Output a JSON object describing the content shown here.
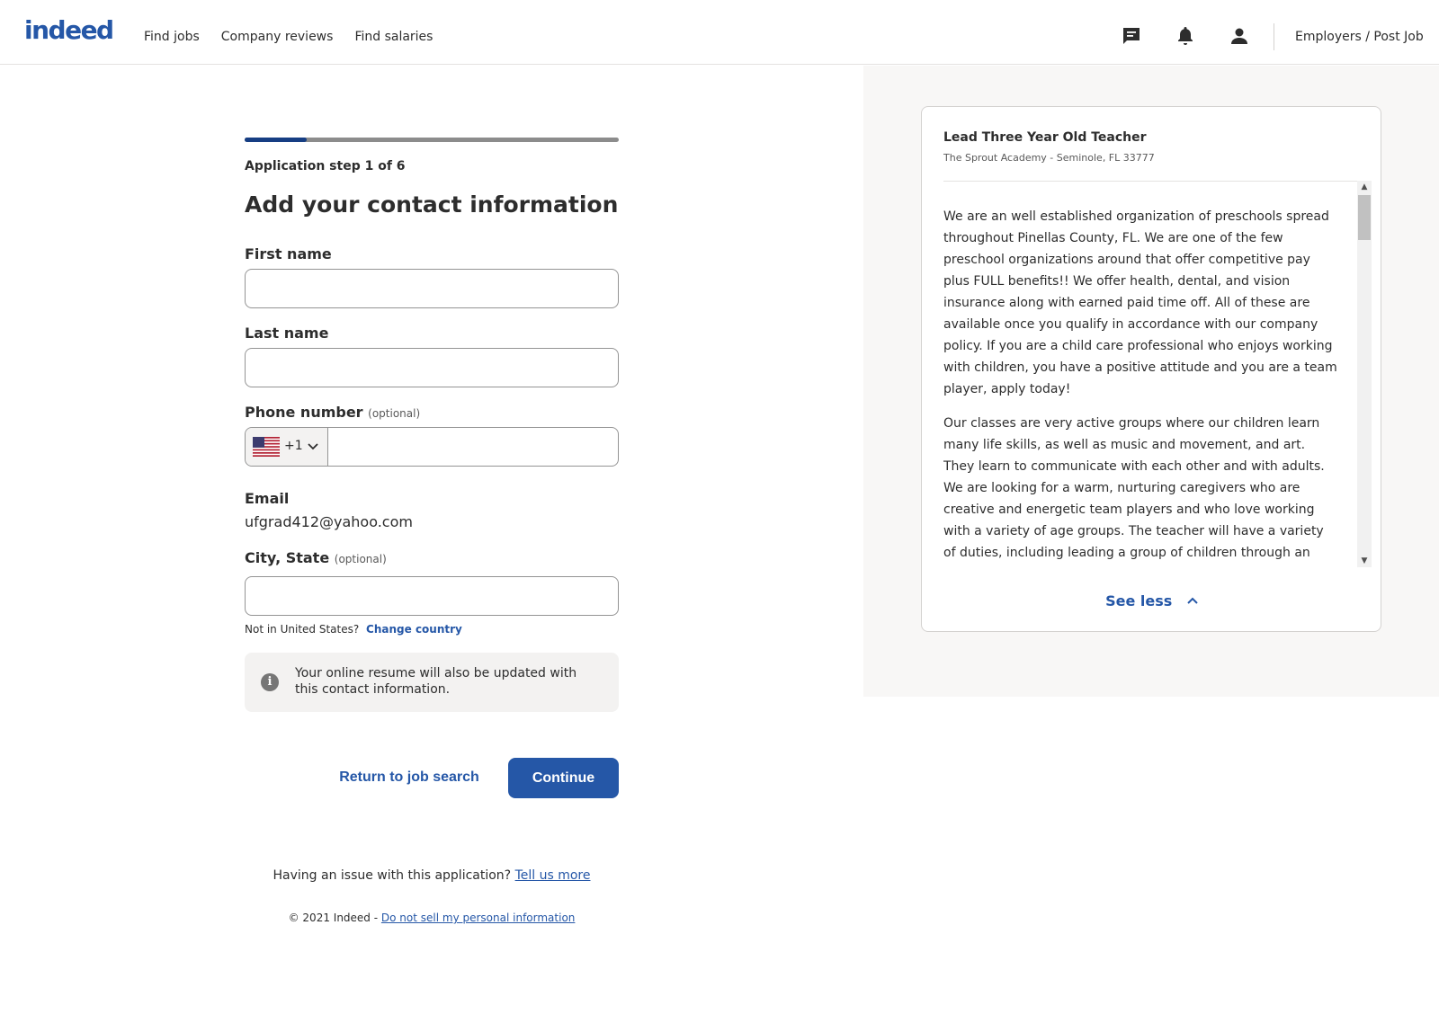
{
  "header": {
    "logo_text": "indeed",
    "nav": [
      "Find jobs",
      "Company reviews",
      "Find salaries"
    ],
    "icons": [
      "messages-icon",
      "notifications-icon",
      "profile-icon"
    ],
    "employers_link": "Employers / Post Job"
  },
  "form": {
    "progress_fraction": 0.1667,
    "step_label": "Application step 1 of 6",
    "title": "Add your contact information",
    "first_name": {
      "label": "First name",
      "value": ""
    },
    "last_name": {
      "label": "Last name",
      "value": ""
    },
    "phone": {
      "label": "Phone number",
      "optional": "(optional)",
      "dial_code": "+1",
      "value": ""
    },
    "email": {
      "label": "Email",
      "value": "ufgrad412@yahoo.com"
    },
    "city_state": {
      "label": "City, State",
      "optional": "(optional)",
      "value": ""
    },
    "not_in_country": "Not in United States?",
    "change_country": "Change country",
    "info_text": "Your online resume will also be updated with this contact information.",
    "return_button": "Return to job search",
    "continue_button": "Continue",
    "issue_text": "Having an issue with this application?",
    "issue_link": "Tell us more",
    "copyright": "© 2021 Indeed -",
    "privacy_link": "Do not sell my personal information"
  },
  "job": {
    "title": "Lead Three Year Old Teacher",
    "company_location": "The Sprout Academy - Seminole, FL 33777",
    "paragraphs": [
      "We are an well established organization of preschools spread throughout Pinellas County, FL. We are one of the few preschool organizations around that offer competitive pay plus FULL benefits!! We offer health, dental, and vision insurance along with earned paid time off. All of these are available once you qualify in accordance with our company policy. If you are a child care professional who enjoys working with children, you have a positive attitude and you are a team player, apply today!",
      "Our classes are very active groups where our children learn many life skills, as well as music and movement, and art. They learn to communicate with each other and with adults. We are looking for a warm, nurturing caregivers who are creative and energetic team players and who love working with a variety of age groups. The teacher will have a variety of duties, including leading a group of children through an educational curriculum, coordinating lesson plans and classroom activities with the lead teacher, and"
    ],
    "see_less": "See less"
  },
  "colors": {
    "brand": "#2557a7",
    "progress_fill": "#163e83",
    "progress_track": "#8c8c8c",
    "panel_bg": "#f8f7f6"
  }
}
